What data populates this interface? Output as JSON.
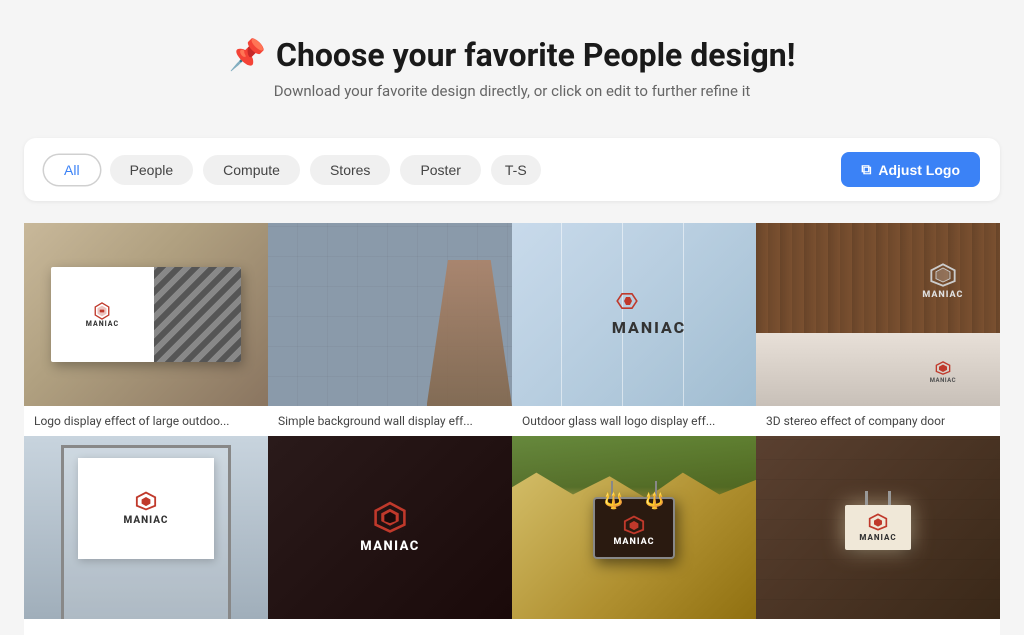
{
  "header": {
    "pin_icon": "📌",
    "title": "Choose your favorite People design!",
    "subtitle": "Download your favorite design directly, or click on edit to further refine it"
  },
  "filter_bar": {
    "pills": [
      {
        "id": "all",
        "label": "All",
        "active": true
      },
      {
        "id": "people",
        "label": "People",
        "active": false
      },
      {
        "id": "compute",
        "label": "Compute",
        "active": false
      },
      {
        "id": "stores",
        "label": "Stores",
        "active": false
      },
      {
        "id": "poster",
        "label": "Poster",
        "active": false
      },
      {
        "id": "more",
        "label": "T-S",
        "active": false
      }
    ],
    "adjust_button": "⊞ Adjust Logo"
  },
  "designs": {
    "row1": [
      {
        "id": "card1",
        "caption": "Logo display effect of large outdoo..."
      },
      {
        "id": "card2",
        "caption": "Simple background wall display eff..."
      },
      {
        "id": "card3",
        "caption": "Outdoor glass wall logo display eff..."
      },
      {
        "id": "card4",
        "caption": "3D stereo effect of company door"
      }
    ],
    "row2": [
      {
        "id": "card5",
        "caption": ""
      },
      {
        "id": "card6",
        "caption": ""
      },
      {
        "id": "card7",
        "caption": ""
      },
      {
        "id": "card8",
        "caption": ""
      }
    ]
  },
  "brand": {
    "name": "MANIAC",
    "accent_color": "#c0392b"
  }
}
